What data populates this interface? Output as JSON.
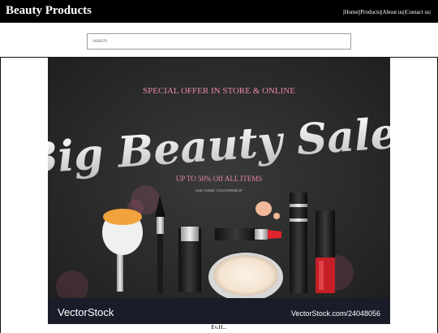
{
  "header": {
    "brand": "Beauty Products",
    "nav": [
      {
        "label": "|Home|"
      },
      {
        "label": "|Products|"
      },
      {
        "label": "|About us|"
      },
      {
        "label": "|Contact us|"
      }
    ]
  },
  "search": {
    "placeholder": "search",
    "value": ""
  },
  "banner": {
    "offer_text": "SPECIAL OFFER IN STORE & ONLINE",
    "headline": "Big Beauty Sale!",
    "discount_text": "UP TO 50% Off ALL ITEMS",
    "code_text": "USE CODE: COLOURMEUP",
    "watermark_brand": "VectorStock",
    "watermark_url": "VectorStock.com/24048056",
    "colors": {
      "background": "#2b2b2b",
      "accent_pink": "#e78aa5",
      "footer_bar": "#1a1c2a",
      "lipstick_red": "#e0262c"
    }
  },
  "caption": "Ev.H..."
}
